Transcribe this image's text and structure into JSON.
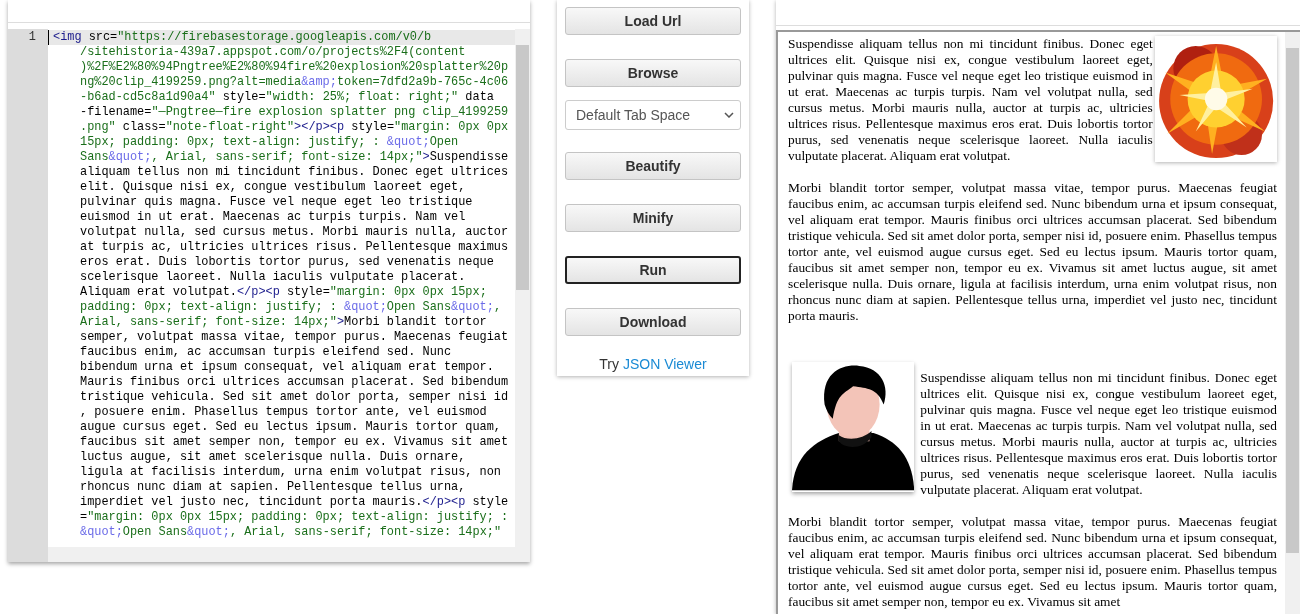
{
  "editor": {
    "line_numbers": [
      "1"
    ],
    "rows": [
      "<img src=\"https://firebasestorage.googleapis.com/v0/b",
      "/sitehistoria-439a7.appspot.com/o/projects%2F4(content",
      ")%2F%E2%80%94Pngtree%E2%80%94fire%20explosion%20splatter%20p",
      "ng%20clip_4199259.png?alt=media&amp;token=7dfd2a9b-765c-4c06",
      "-b6ad-cd5c8a1d90a4\" style=\"width: 25%; float: right;\" data",
      "-filename=\"—Pngtree—fire explosion splatter png clip_4199259",
      ".png\" class=\"note-float-right\"></p><p style=\"margin: 0px 0px",
      "15px; padding: 0px; text-align: justify; : &quot;Open",
      "Sans&quot;, Arial, sans-serif; font-size: 14px;\">Suspendisse",
      "aliquam tellus non mi tincidunt finibus. Donec eget ultrices",
      "elit. Quisque nisi ex, congue vestibulum laoreet eget,",
      "pulvinar quis magna. Fusce vel neque eget leo tristique",
      "euismod in ut erat. Maecenas ac turpis turpis. Nam vel",
      "volutpat nulla, sed cursus metus. Morbi mauris nulla, auctor",
      "at turpis ac, ultricies ultrices risus. Pellentesque maximus",
      "eros erat. Duis lobortis tortor purus, sed venenatis neque",
      "scelerisque laoreet. Nulla iaculis vulputate placerat.",
      "Aliquam erat volutpat.</p><p style=\"margin: 0px 0px 15px;",
      "padding: 0px; text-align: justify; : &quot;Open Sans&quot;,",
      "Arial, sans-serif; font-size: 14px;\">Morbi blandit tortor",
      "semper, volutpat massa vitae, tempor purus. Maecenas feugiat",
      "faucibus enim, ac accumsan turpis eleifend sed. Nunc",
      "bibendum urna et ipsum consequat, vel aliquam erat tempor.",
      "Mauris finibus orci ultrices accumsan placerat. Sed bibendum",
      "tristique vehicula. Sed sit amet dolor porta, semper nisi id",
      ", posuere enim. Phasellus tempus tortor ante, vel euismod",
      "augue cursus eget. Sed eu lectus ipsum. Mauris tortor quam,",
      "faucibus sit amet semper non, tempor eu ex. Vivamus sit amet",
      "luctus augue, sit amet scelerisque nulla. Duis ornare,",
      "ligula at facilisis interdum, urna enim volutpat risus, non",
      "rhoncus nunc diam at sapien. Pellentesque tellus urna,",
      "imperdiet vel justo nec, tincidunt porta mauris.</p><p style",
      "=\"margin: 0px 0px 15px; padding: 0px; text-align: justify; :",
      "&quot;Open Sans&quot;, Arial, sans-serif; font-size: 14px;\""
    ]
  },
  "controls": [
    {
      "kind": "button",
      "label": "Load Url",
      "focused": false
    },
    {
      "kind": "button",
      "label": "Browse",
      "focused": false
    },
    {
      "kind": "select",
      "value": "Default Tab Space"
    },
    {
      "kind": "button",
      "label": "Beautify",
      "focused": false
    },
    {
      "kind": "button",
      "label": "Minify",
      "focused": false
    },
    {
      "kind": "button",
      "label": "Run",
      "focused": true
    },
    {
      "kind": "button",
      "label": "Download",
      "focused": false
    }
  ],
  "try_line": {
    "prefix": "Try",
    "link": "JSON Viewer"
  },
  "output": {
    "sections": [
      {
        "paragraphs": [
          "Suspendisse aliquam tellus non mi tincidunt finibus. Donec eget ultrices elit. Quisque nisi ex, congue vestibulum laoreet eget, pulvinar quis magna. Fusce vel neque eget leo tristique euismod in ut erat. Maecenas ac turpis turpis. Nam vel volutpat nulla, sed cursus metus. Morbi mauris nulla, auctor at turpis ac, ultricies ultrices risus. Pellentesque maximus eros erat. Duis lobortis tortor purus, sed venenatis neque scelerisque laoreet. Nulla iaculis vulputate placerat. Aliquam erat volutpat.",
          "Morbi blandit tortor semper, volutpat massa vitae, tempor purus. Maecenas feugiat faucibus enim, ac accumsan turpis eleifend sed. Nunc bibendum urna et ipsum consequat, vel aliquam erat tempor. Mauris finibus orci ultrices accumsan placerat. Sed bibendum tristique vehicula. Sed sit amet dolor porta, semper nisi id, posuere enim. Phasellus tempus tortor ante, vel euismod augue cursus eget. Sed eu lectus ipsum. Mauris tortor quam, faucibus sit amet semper non, tempor eu ex. Vivamus sit amet luctus augue, sit amet scelerisque nulla. Duis ornare, ligula at facilisis interdum, urna enim volutpat risus, non rhoncus nunc diam at sapien. Pellentesque tellus urna, imperdiet vel justo nec, tincidunt porta mauris."
        ]
      },
      {
        "paragraphs": [
          "Suspendisse aliquam tellus non mi tincidunt finibus. Donec eget ultrices elit. Quisque nisi ex, congue vestibulum laoreet eget, pulvinar quis magna. Fusce vel neque eget leo tristique euismod in ut erat. Maecenas ac turpis turpis. Nam vel volutpat nulla, sed cursus metus. Morbi mauris nulla, auctor at turpis ac, ultricies ultrices risus. Pellentesque maximus eros erat. Duis lobortis tortor purus, sed venenatis neque scelerisque laoreet. Nulla iaculis vulputate placerat. Aliquam erat volutpat.",
          "Morbi blandit tortor semper, volutpat massa vitae, tempor purus. Maecenas feugiat faucibus enim, ac accumsan turpis eleifend sed. Nunc bibendum urna et ipsum consequat, vel aliquam erat tempor. Mauris finibus orci ultrices accumsan placerat. Sed bibendum tristique vehicula. Sed sit amet dolor porta, semper nisi id, posuere enim. Phasellus tempus tortor ante, vel euismod augue cursus eget. Sed eu lectus ipsum. Mauris tortor quam, faucibus sit amet semper non, tempor eu ex. Vivamus sit amet"
        ]
      }
    ]
  }
}
